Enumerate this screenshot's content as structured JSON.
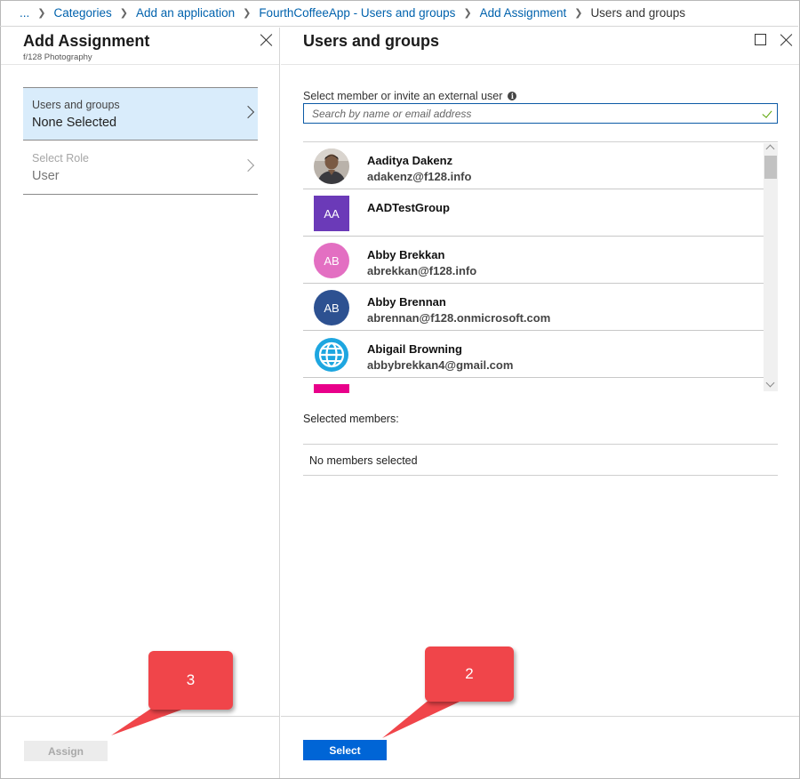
{
  "breadcrumb": {
    "ellipsis": "...",
    "items": [
      "Categories",
      "Add an application",
      "FourthCoffeeApp - Users and groups",
      "Add Assignment"
    ],
    "current": "Users and groups"
  },
  "left_blade": {
    "title": "Add Assignment",
    "subtitle": "f/128 Photography",
    "menu": [
      {
        "label": "Users and groups",
        "value": "None Selected",
        "selected": true,
        "disabled": false
      },
      {
        "label": "Select Role",
        "value": "User",
        "selected": false,
        "disabled": true
      }
    ],
    "assign_label": "Assign"
  },
  "right_blade": {
    "title": "Users and groups",
    "search": {
      "label": "Select member or invite an external user",
      "placeholder": "Search by name or email address",
      "value": ""
    },
    "users": [
      {
        "name": "Aaditya Dakenz",
        "email": "adakenz@f128.info",
        "avatar": "photo",
        "initials": "",
        "color": "#5b4a3f"
      },
      {
        "name": "AADTestGroup",
        "email": "",
        "avatar": "group",
        "initials": "AA",
        "color": "#6b3ab8"
      },
      {
        "name": "Abby Brekkan",
        "email": "abrekkan@f128.info",
        "avatar": "initials",
        "initials": "AB",
        "color": "#e36fc2"
      },
      {
        "name": "Abby Brennan",
        "email": "abrennan@f128.onmicrosoft.com",
        "avatar": "initials",
        "initials": "AB",
        "color": "#2d5191"
      },
      {
        "name": "Abigail Browning",
        "email": "abbybrekkan4@gmail.com",
        "avatar": "globe",
        "initials": "",
        "color": "#1ea6e0"
      },
      {
        "name": "",
        "email": "",
        "avatar": "group",
        "initials": "",
        "color": "#e8008a"
      }
    ],
    "selected_members_label": "Selected members:",
    "no_members_text": "No members selected",
    "select_label": "Select"
  },
  "callouts": [
    {
      "number": "3",
      "color": "#f0454a"
    },
    {
      "number": "2",
      "color": "#f0454a"
    }
  ]
}
